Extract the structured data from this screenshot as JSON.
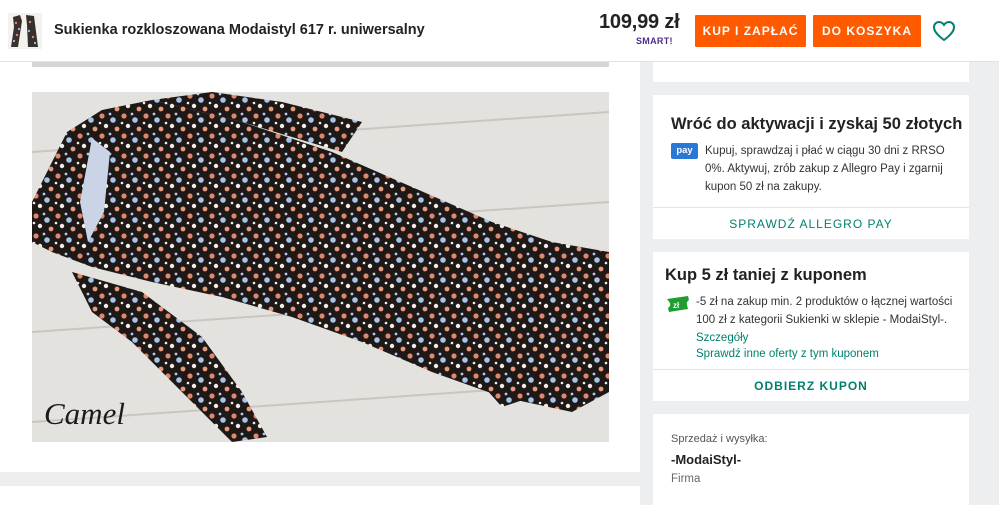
{
  "header": {
    "title": "Sukienka rozkloszowana Modaistyl 617 r. uniwersalny",
    "price": "109,99 zł",
    "smart_badge": "SMART!",
    "buy_now_label": "KUP I ZAPŁAĆ",
    "add_to_cart_label": "DO KOSZYKA"
  },
  "gallery": {
    "photo_caption": "Camel"
  },
  "allegro_pay_card": {
    "heading": "Wróć do aktywacji i zyskaj 50 złotych",
    "badge": "pay",
    "text": "Kupuj, sprawdzaj i płać w ciągu 30 dni z RRSO 0%. Aktywuj, zrób zakup z Allegro Pay i zgarnij kupon 50 zł na zakupy.",
    "link_label": "SPRAWDŹ ALLEGRO PAY"
  },
  "coupon_card": {
    "heading": "Kup 5 zł taniej z kuponem",
    "text": "-5 zł na zakup min. 2 produktów o łącznej wartości 100 zł z kategorii Sukienki w sklepie - ModaiStyl-.",
    "details_link": "Szczegóły",
    "other_offers_link": "Sprawdź inne oferty z tym kuponem",
    "claim_label": "ODBIERZ KUPON"
  },
  "seller_card": {
    "label": "Sprzedaż i wysyłka:",
    "name": "-ModaiStyl-",
    "type": "Firma"
  },
  "colors": {
    "accent_orange": "#ff5a00",
    "link_teal": "#00806f",
    "pay_blue": "#2978d6",
    "coupon_green": "#1e9e2f",
    "page_background": "#eceeef"
  },
  "icons": {
    "wishlist": "heart-outline-icon",
    "coupon": "ticket-icon",
    "smart": "smart-badge-icon"
  }
}
